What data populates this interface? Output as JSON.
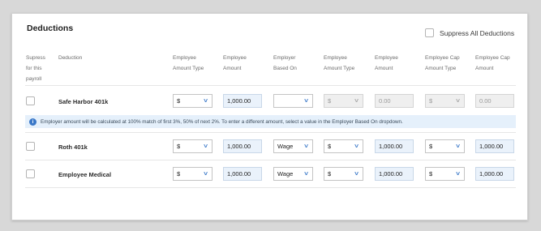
{
  "title": "Deductions",
  "suppress_all_label": "Suppress All Deductions",
  "headers": {
    "suppress": [
      "Supress",
      "for this",
      "payroll"
    ],
    "deduction": "Deduction",
    "employee_amount_type": [
      "Employee",
      "Amount Type"
    ],
    "employee_amount": [
      "Employee",
      "Amount"
    ],
    "employer_based_on": [
      "Employer",
      "Based On"
    ],
    "employee_amount_type_2": [
      "Employee",
      "Amount Type"
    ],
    "employee_amount_2": [
      "Employee",
      "Amount"
    ],
    "employee_cap_amount_type": [
      "Employee Cap",
      "Amount Type"
    ],
    "employee_cap_amount": [
      "Employee Cap",
      "Amount"
    ]
  },
  "info_message": "Employer amount will be calculated at 100% match of first 3%, 50% of next 2%. To enter a different amount, select a value in the Employer Based On dropdown.",
  "rows": [
    {
      "name": "Safe Harbor 401k",
      "emp_type": "$",
      "emp_amount": "1,000.00",
      "based_on": "",
      "er_type": "$",
      "er_amount": "0.00",
      "cap_type": "$",
      "cap_amount": "0.00"
    },
    {
      "name": "Roth 401k",
      "emp_type": "$",
      "emp_amount": "1,000.00",
      "based_on": "Wage",
      "er_type": "$",
      "er_amount": "1,000.00",
      "cap_type": "$",
      "cap_amount": "1,000.00"
    },
    {
      "name": "Employee Medical",
      "emp_type": "$",
      "emp_amount": "1,000.00",
      "based_on": "Wage",
      "er_type": "$",
      "er_amount": "1,000.00",
      "cap_type": "$",
      "cap_amount": "1,000.00"
    }
  ]
}
